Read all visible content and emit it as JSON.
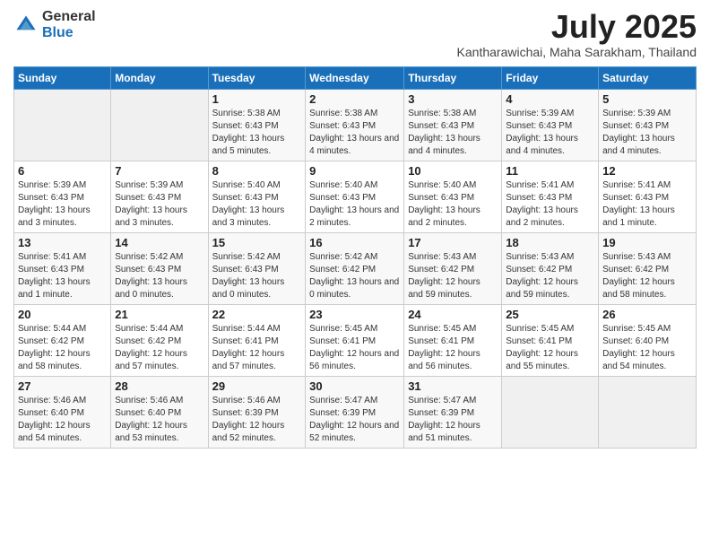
{
  "logo": {
    "general": "General",
    "blue": "Blue"
  },
  "title": "July 2025",
  "subtitle": "Kantharawichai, Maha Sarakham, Thailand",
  "days_of_week": [
    "Sunday",
    "Monday",
    "Tuesday",
    "Wednesday",
    "Thursday",
    "Friday",
    "Saturday"
  ],
  "weeks": [
    [
      {
        "day": "",
        "detail": ""
      },
      {
        "day": "",
        "detail": ""
      },
      {
        "day": "1",
        "detail": "Sunrise: 5:38 AM\nSunset: 6:43 PM\nDaylight: 13 hours and 5 minutes."
      },
      {
        "day": "2",
        "detail": "Sunrise: 5:38 AM\nSunset: 6:43 PM\nDaylight: 13 hours and 4 minutes."
      },
      {
        "day": "3",
        "detail": "Sunrise: 5:38 AM\nSunset: 6:43 PM\nDaylight: 13 hours and 4 minutes."
      },
      {
        "day": "4",
        "detail": "Sunrise: 5:39 AM\nSunset: 6:43 PM\nDaylight: 13 hours and 4 minutes."
      },
      {
        "day": "5",
        "detail": "Sunrise: 5:39 AM\nSunset: 6:43 PM\nDaylight: 13 hours and 4 minutes."
      }
    ],
    [
      {
        "day": "6",
        "detail": "Sunrise: 5:39 AM\nSunset: 6:43 PM\nDaylight: 13 hours and 3 minutes."
      },
      {
        "day": "7",
        "detail": "Sunrise: 5:39 AM\nSunset: 6:43 PM\nDaylight: 13 hours and 3 minutes."
      },
      {
        "day": "8",
        "detail": "Sunrise: 5:40 AM\nSunset: 6:43 PM\nDaylight: 13 hours and 3 minutes."
      },
      {
        "day": "9",
        "detail": "Sunrise: 5:40 AM\nSunset: 6:43 PM\nDaylight: 13 hours and 2 minutes."
      },
      {
        "day": "10",
        "detail": "Sunrise: 5:40 AM\nSunset: 6:43 PM\nDaylight: 13 hours and 2 minutes."
      },
      {
        "day": "11",
        "detail": "Sunrise: 5:41 AM\nSunset: 6:43 PM\nDaylight: 13 hours and 2 minutes."
      },
      {
        "day": "12",
        "detail": "Sunrise: 5:41 AM\nSunset: 6:43 PM\nDaylight: 13 hours and 1 minute."
      }
    ],
    [
      {
        "day": "13",
        "detail": "Sunrise: 5:41 AM\nSunset: 6:43 PM\nDaylight: 13 hours and 1 minute."
      },
      {
        "day": "14",
        "detail": "Sunrise: 5:42 AM\nSunset: 6:43 PM\nDaylight: 13 hours and 0 minutes."
      },
      {
        "day": "15",
        "detail": "Sunrise: 5:42 AM\nSunset: 6:43 PM\nDaylight: 13 hours and 0 minutes."
      },
      {
        "day": "16",
        "detail": "Sunrise: 5:42 AM\nSunset: 6:42 PM\nDaylight: 13 hours and 0 minutes."
      },
      {
        "day": "17",
        "detail": "Sunrise: 5:43 AM\nSunset: 6:42 PM\nDaylight: 12 hours and 59 minutes."
      },
      {
        "day": "18",
        "detail": "Sunrise: 5:43 AM\nSunset: 6:42 PM\nDaylight: 12 hours and 59 minutes."
      },
      {
        "day": "19",
        "detail": "Sunrise: 5:43 AM\nSunset: 6:42 PM\nDaylight: 12 hours and 58 minutes."
      }
    ],
    [
      {
        "day": "20",
        "detail": "Sunrise: 5:44 AM\nSunset: 6:42 PM\nDaylight: 12 hours and 58 minutes."
      },
      {
        "day": "21",
        "detail": "Sunrise: 5:44 AM\nSunset: 6:42 PM\nDaylight: 12 hours and 57 minutes."
      },
      {
        "day": "22",
        "detail": "Sunrise: 5:44 AM\nSunset: 6:41 PM\nDaylight: 12 hours and 57 minutes."
      },
      {
        "day": "23",
        "detail": "Sunrise: 5:45 AM\nSunset: 6:41 PM\nDaylight: 12 hours and 56 minutes."
      },
      {
        "day": "24",
        "detail": "Sunrise: 5:45 AM\nSunset: 6:41 PM\nDaylight: 12 hours and 56 minutes."
      },
      {
        "day": "25",
        "detail": "Sunrise: 5:45 AM\nSunset: 6:41 PM\nDaylight: 12 hours and 55 minutes."
      },
      {
        "day": "26",
        "detail": "Sunrise: 5:45 AM\nSunset: 6:40 PM\nDaylight: 12 hours and 54 minutes."
      }
    ],
    [
      {
        "day": "27",
        "detail": "Sunrise: 5:46 AM\nSunset: 6:40 PM\nDaylight: 12 hours and 54 minutes."
      },
      {
        "day": "28",
        "detail": "Sunrise: 5:46 AM\nSunset: 6:40 PM\nDaylight: 12 hours and 53 minutes."
      },
      {
        "day": "29",
        "detail": "Sunrise: 5:46 AM\nSunset: 6:39 PM\nDaylight: 12 hours and 52 minutes."
      },
      {
        "day": "30",
        "detail": "Sunrise: 5:47 AM\nSunset: 6:39 PM\nDaylight: 12 hours and 52 minutes."
      },
      {
        "day": "31",
        "detail": "Sunrise: 5:47 AM\nSunset: 6:39 PM\nDaylight: 12 hours and 51 minutes."
      },
      {
        "day": "",
        "detail": ""
      },
      {
        "day": "",
        "detail": ""
      }
    ]
  ]
}
